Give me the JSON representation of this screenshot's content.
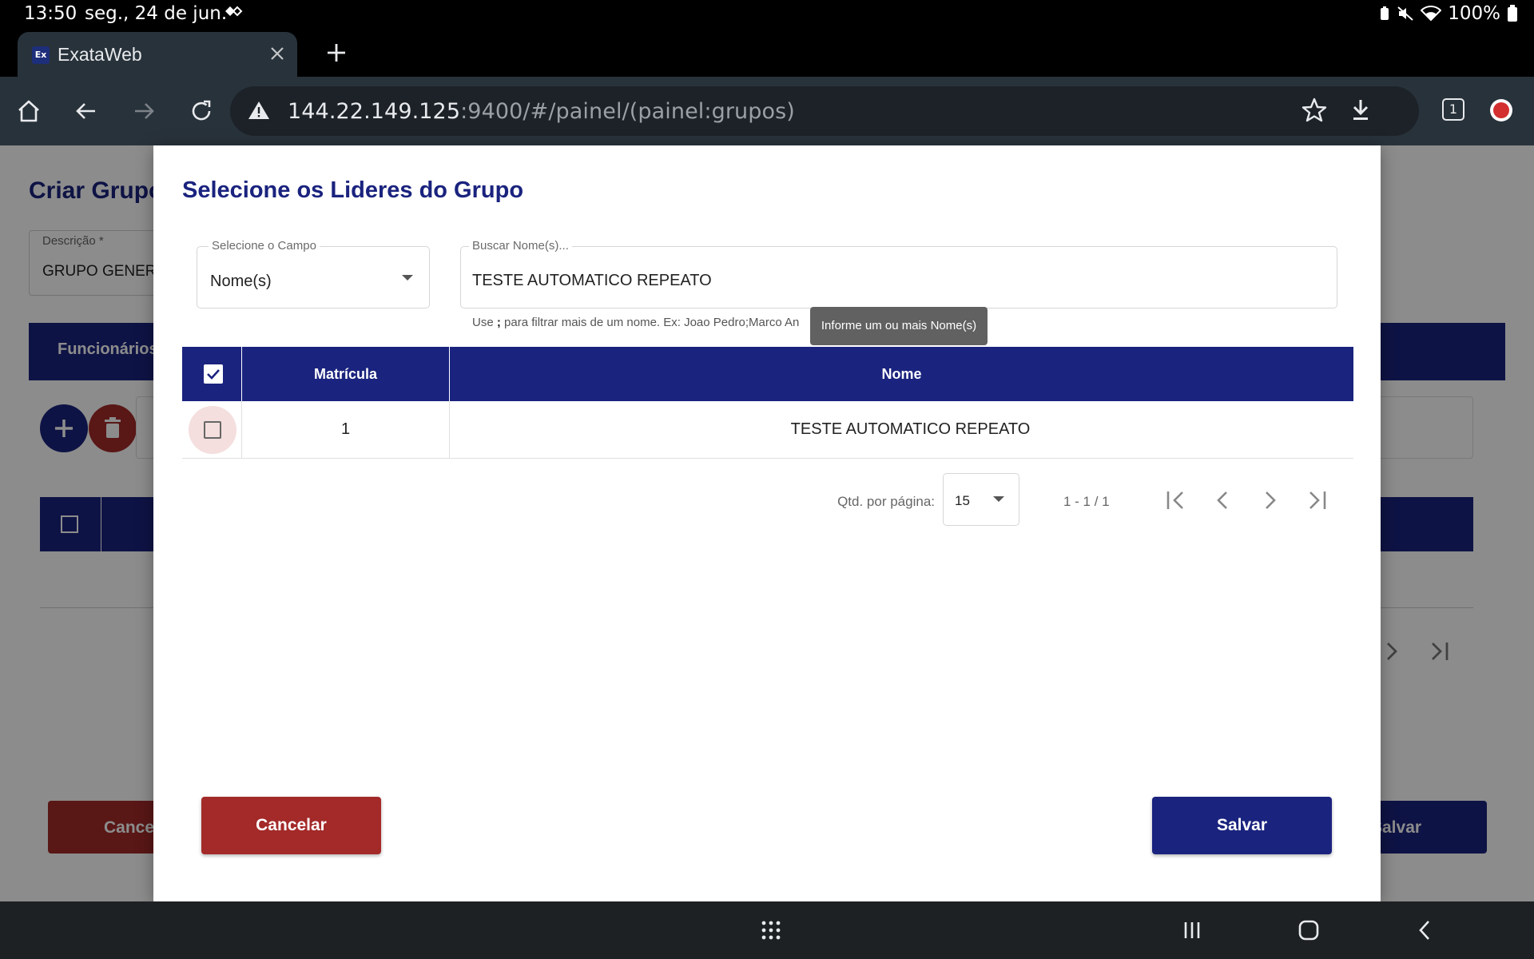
{
  "status_bar": {
    "time": "13:50",
    "date": "seg., 24 de jun.",
    "battery": "100%"
  },
  "browser": {
    "tab_title": "ExataWeb",
    "favicon_text": "Ex",
    "url_host": "144.22.149.125",
    "url_rest": ":9400/#/painel/(painel:grupos)",
    "tab_count": "1"
  },
  "background_page": {
    "title": "Criar Grupo",
    "description_label": "Descrição *",
    "description_value": "GRUPO GENER",
    "tab_funcionarios": "Funcionários",
    "cancel_label": "Cancel",
    "save_label": "Salvar"
  },
  "dialog": {
    "title": "Selecione os Lideres do Grupo",
    "field_select": {
      "label": "Selecione o Campo",
      "value": "Nome(s)"
    },
    "search": {
      "label": "Buscar Nome(s)...",
      "value": "TESTE AUTOMATICO REPEATO"
    },
    "hint_prefix": "Use ",
    "hint_separator": ";",
    "hint_suffix": " para filtrar mais de um nome. Ex: Joao Pedro;Marco An",
    "tooltip": "Informe um ou mais Nome(s)",
    "table": {
      "columns": [
        "Matrícula",
        "Nome"
      ],
      "rows": [
        {
          "matricula": "1",
          "nome": "TESTE AUTOMATICO REPEATO",
          "checked": false
        }
      ],
      "header_checked": true
    },
    "paginator": {
      "per_page_label": "Qtd. por página:",
      "per_page_value": "15",
      "range": "1 - 1 / 1"
    },
    "cancel_label": "Cancelar",
    "save_label": "Salvar"
  },
  "colors": {
    "primary": "#1a237e",
    "danger": "#a32a29",
    "tooltip": "#616161"
  }
}
